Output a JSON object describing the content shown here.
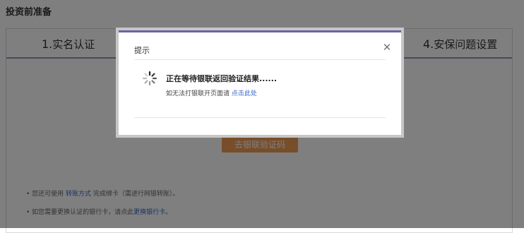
{
  "page": {
    "title": "投资前准备"
  },
  "steps": [
    {
      "num": "1.",
      "label": "实名认证"
    },
    {
      "num": "4.",
      "label": "安保问题设置"
    }
  ],
  "main": {
    "action_button": "去银联验证码",
    "tips": [
      {
        "prefix": "• 您还可使用 ",
        "link": "转账方式",
        "suffix": " 完成绑卡（需进行网银转账）。"
      },
      {
        "prefix": "• 如您需要更换认证的银行卡，请点此",
        "link": "更换银行卡",
        "suffix": "。"
      }
    ]
  },
  "modal": {
    "title": "提示",
    "close_icon": "close-icon",
    "spinner_icon": "loading-spinner-icon",
    "message": "正在等待银联返回验证结果......",
    "sub_prefix": "如无法打银联开页面请 ",
    "sub_link": "点击此处"
  },
  "colors": {
    "overlay": "rgba(0,0,0,0.5)",
    "modal_accent": "#6a63a8",
    "link": "#3a66c9",
    "action_button": "#f09a55",
    "step_underline": "#8a92b8"
  }
}
